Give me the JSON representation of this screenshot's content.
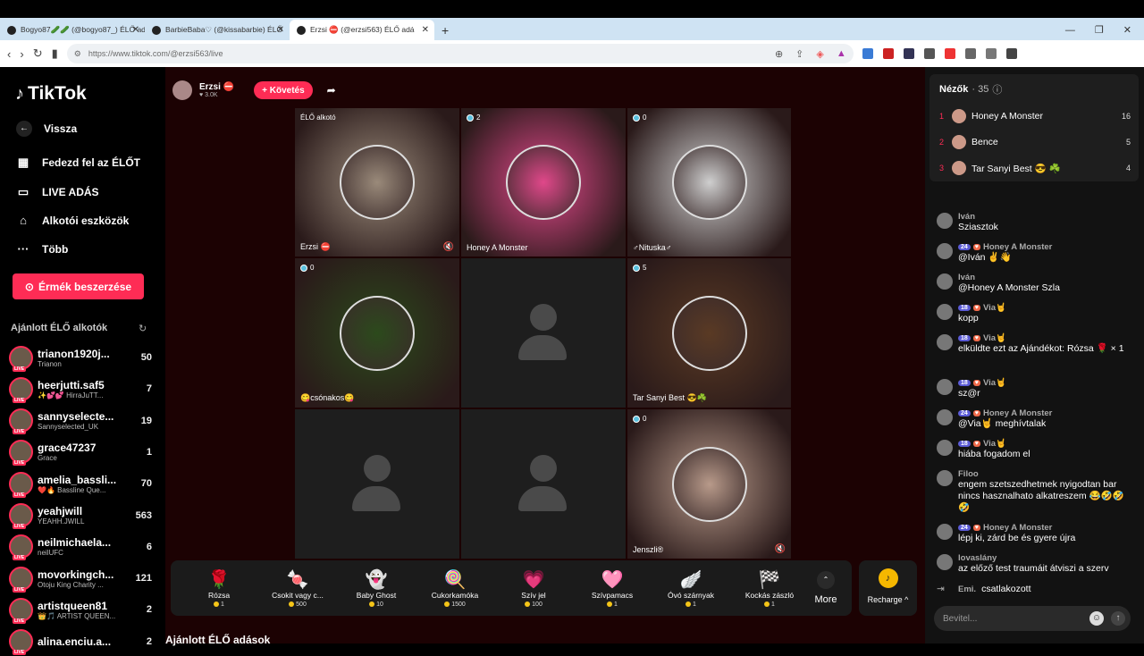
{
  "browser": {
    "tabs": [
      {
        "title": "Bogyo87🥒🥒 (@bogyo87_) ÉLŐ ad"
      },
      {
        "title": "BarbieBaba♡ (@kissabarbie) ÉLŐ"
      },
      {
        "title": "Erzsi ⛔ (@erzsi563) ÉLŐ adá"
      }
    ],
    "url": "https://www.tiktok.com/@erzsi563/live"
  },
  "sidebar": {
    "logo": "TikTok",
    "back": "Vissza",
    "nav": [
      "Fedezd fel az ÉLŐT",
      "LIVE ADÁS",
      "Alkotói eszközök",
      "Több"
    ],
    "coins_button": "Érmék beszerzése",
    "suggested_title": "Ajánlott ÉLŐ alkotók",
    "suggested": [
      {
        "name": "trianon1920j...",
        "desc": "Trianon",
        "count": "50"
      },
      {
        "name": "heerjutti.saf5",
        "desc": "✨💕💕 HirraJuTT...",
        "count": "7"
      },
      {
        "name": "sannyselecte...",
        "desc": "Sannyselected_UK",
        "count": "19"
      },
      {
        "name": "grace47237",
        "desc": "Grace",
        "count": "1"
      },
      {
        "name": "amelia_bassli...",
        "desc": "❤️🔥 Bassline Que...",
        "count": "70"
      },
      {
        "name": "yeahjwill",
        "desc": "YEAHH.JWILL",
        "count": "563"
      },
      {
        "name": "neilmichaela...",
        "desc": "neilUFC",
        "count": "6"
      },
      {
        "name": "movorkingch...",
        "desc": "Otoju King Charity ...",
        "count": "121"
      },
      {
        "name": "artistqueen81",
        "desc": "👑🎵 ARTIST QUEEN...",
        "count": "2"
      },
      {
        "name": "alina.enciu.a...",
        "desc": "",
        "count": "2"
      }
    ]
  },
  "host": {
    "name": "Erzsi ⛔",
    "likes": "♥ 3.0K",
    "follow": "+ Követés"
  },
  "grid": [
    {
      "tag": "ÉLŐ alkotó",
      "name": "Erzsi ⛔",
      "count": "",
      "muted": true,
      "color": "#9a8a7a"
    },
    {
      "tag": "",
      "name": "Honey A Monster",
      "count": "2",
      "muted": false,
      "color": "#e0488a"
    },
    {
      "tag": "",
      "name": "♂Nituska♂",
      "count": "0",
      "muted": false,
      "color": "#cfcfcf"
    },
    {
      "tag": "",
      "name": "😋csónakos😋",
      "count": "0",
      "muted": false,
      "color": "#2c4a1c"
    },
    {
      "tag": "",
      "name": "",
      "count": "",
      "muted": false,
      "color": ""
    },
    {
      "tag": "",
      "name": "Tar Sanyi Best 😎☘️",
      "count": "5",
      "muted": false,
      "color": "#5a3a24"
    },
    {
      "tag": "",
      "name": "",
      "count": "",
      "muted": false,
      "color": ""
    },
    {
      "tag": "",
      "name": "",
      "count": "",
      "muted": false,
      "color": ""
    },
    {
      "tag": "",
      "name": "Jenszli®",
      "count": "0",
      "muted": true,
      "color": "#b89a8a"
    }
  ],
  "gifts": [
    {
      "name": "Rózsa",
      "price": "1",
      "icon": "🌹"
    },
    {
      "name": "Csokit vagy c...",
      "price": "500",
      "icon": "🍬"
    },
    {
      "name": "Baby Ghost",
      "price": "10",
      "icon": "👻"
    },
    {
      "name": "Cukorkamóka",
      "price": "1500",
      "icon": "🍭"
    },
    {
      "name": "Szív jel",
      "price": "100",
      "icon": "💗"
    },
    {
      "name": "Szívpamacs",
      "price": "1",
      "icon": "🩷"
    },
    {
      "name": "Óvó szárnyak",
      "price": "1",
      "icon": "🪽"
    },
    {
      "name": "Kockás zászló",
      "price": "1",
      "icon": "🏁"
    }
  ],
  "more_label": "More",
  "recharge_label": "Recharge ^",
  "suggested_live": "Ajánlott ÉLŐ adások",
  "viewers": {
    "title": "Nézők",
    "count": "· 35",
    "list": [
      {
        "rank": "1",
        "name": "Honey A Monster",
        "score": "16"
      },
      {
        "rank": "2",
        "name": "Bence",
        "score": "5"
      },
      {
        "rank": "3",
        "name": "Tar Sanyi Best 😎 ☘️",
        "score": "4"
      }
    ]
  },
  "chat": [
    {
      "user": "Iván",
      "level": "",
      "text": "Sziasztok"
    },
    {
      "user": "Honey A Monster",
      "level": "24",
      "text": "@Iván ✌️👋"
    },
    {
      "user": "Iván",
      "level": "",
      "text": "@Honey A Monster Szla"
    },
    {
      "user": "Via🤘",
      "level": "18",
      "text": "kopp"
    },
    {
      "user": "Via🤘",
      "level": "18",
      "text": "elküldte ezt az Ajándékot: Rózsa 🌹 × 1"
    },
    {
      "user": "Via🤘",
      "level": "18",
      "text": "sz@r"
    },
    {
      "user": "Honey A Monster",
      "level": "24",
      "text": "@Via🤘 meghívtalak"
    },
    {
      "user": "Via🤘",
      "level": "18",
      "text": "hiába fogadom el"
    },
    {
      "user": "Filoo",
      "level": "",
      "text": "engem szetszedhetmek nyigodtan bar nincs hasznalhato alkatreszem 😂🤣🤣🤣"
    },
    {
      "user": "Honey A Monster",
      "level": "24",
      "text": "lépj ki, zárd be és gyere újra"
    },
    {
      "user": "lovaslány",
      "level": "",
      "text": "az előző test traumáit átviszi a szerv"
    },
    {
      "user": "Emi.",
      "level": "",
      "text": "csatlakozott"
    }
  ],
  "chat_input_placeholder": "Bevitel..."
}
